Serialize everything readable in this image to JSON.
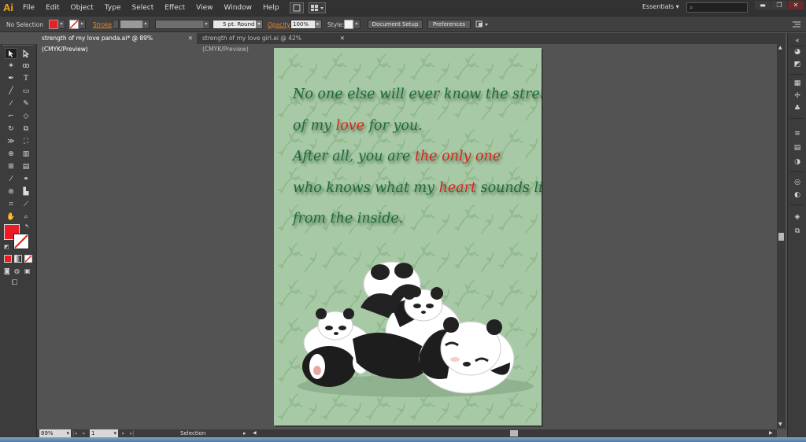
{
  "app": {
    "logo": "Ai"
  },
  "menu": [
    "File",
    "Edit",
    "Object",
    "Type",
    "Select",
    "Effect",
    "View",
    "Window",
    "Help"
  ],
  "workspace": "Essentials",
  "controlbar": {
    "selection": "No Selection",
    "stroke_label": "Stroke:",
    "brush": "5 pt. Round",
    "opacity_label": "Opacity:",
    "opacity_value": "100%",
    "style_label": "Style:",
    "doc_setup": "Document Setup",
    "preferences": "Preferences",
    "fill_color": "#ee1c25"
  },
  "tabs": [
    {
      "label": "strength of my love panda.ai* @ 89% (CMYK/Preview)",
      "active": true
    },
    {
      "label": "strength of my love girl.ai @ 42% (CMYK/Preview)",
      "active": false
    }
  ],
  "poem": {
    "line1": "No one else will ever know the strength",
    "line2_a": "of my ",
    "line2_hl": "love",
    "line2_b": " for you.",
    "line3_a": "After all, you are ",
    "line3_hl": "the only one",
    "line4_a": "who knows what my ",
    "line4_hl": "heart",
    "line4_b": " sounds like",
    "line5": "from the inside."
  },
  "status": {
    "zoom": "89%",
    "page": "1",
    "tool": "Selection"
  },
  "colors": {
    "artboard_bg": "#a8c9a6",
    "text_green": "#1e6a3c",
    "text_red": "#d9241b",
    "accent": "#ee1c25"
  }
}
